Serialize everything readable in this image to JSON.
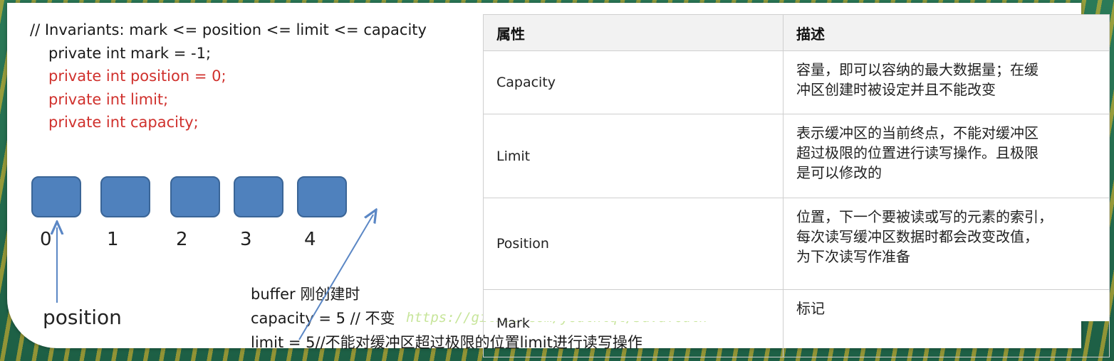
{
  "code": {
    "comment": "// Invariants: mark <= position <= limit <= capacity",
    "lines": [
      "private int mark = -1;",
      "private int position = 0;",
      "private int limit;",
      "private int capacity;"
    ]
  },
  "buffer": {
    "indices": [
      "0",
      "1",
      "2",
      "3",
      "4"
    ],
    "position_label": "position"
  },
  "notes": {
    "line1": "buffer 刚创建时",
    "line2": "capacity = 5 // 不变",
    "line3": "limit = 5//不能对缓冲区超过极限的位置limit进行读写操作"
  },
  "watermark": "https://github.com/youthlql/JavaYouth",
  "table": {
    "headers": [
      "属性",
      "描述"
    ],
    "rows": [
      {
        "prop": "Capacity",
        "desc_lines": [
          "容量，即可以容纳的最大数据量；在缓",
          "冲区创建时被设定并且不能改变"
        ]
      },
      {
        "prop": "Limit",
        "desc_lines": [
          "表示缓冲区的当前终点，不能对缓冲区",
          "超过极限的位置进行读写操作。且极限",
          "是可以修改的"
        ]
      },
      {
        "prop": "Position",
        "desc_lines": [
          "位置，下一个要被读或写的元素的索引，",
          "每次读写缓冲区数据时都会改变改值，",
          "为下次读写作准备"
        ]
      },
      {
        "prop": "Mark",
        "desc_lines": [
          "标记"
        ]
      }
    ]
  },
  "colors": {
    "highlight_red": "#d0312d",
    "buffer_cell": "#4f81bd",
    "arrow": "#5b87c5"
  }
}
